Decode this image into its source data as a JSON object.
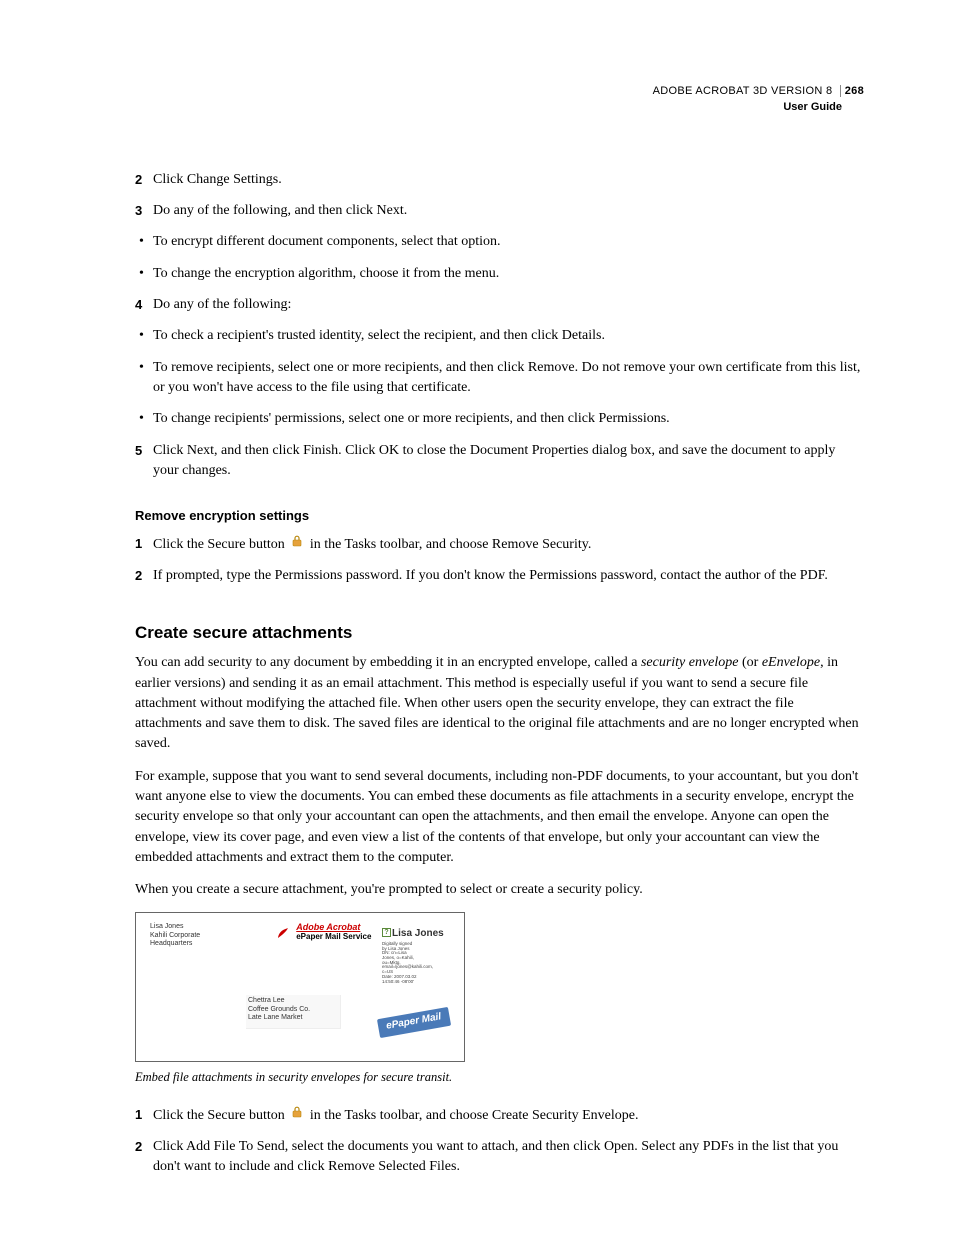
{
  "header": {
    "product": "ADOBE ACROBAT 3D VERSION 8",
    "guide": "User Guide",
    "page_number": "268"
  },
  "steps1": {
    "s2": {
      "num": "2",
      "text": "Click Change Settings."
    },
    "s3": {
      "num": "3",
      "text": "Do any of the following, and then click Next."
    },
    "b3a": "To encrypt different document components, select that option.",
    "b3b": "To change the encryption algorithm, choose it from the menu.",
    "s4": {
      "num": "4",
      "text": "Do any of the following:"
    },
    "b4a": "To check a recipient's trusted identity, select the recipient, and then click Details.",
    "b4b": "To remove recipients, select one or more recipients, and then click Remove. Do not remove your own certificate from this list, or you won't have access to the file using that certificate.",
    "b4c": "To change recipients' permissions, select one or more recipients, and then click Permissions.",
    "s5": {
      "num": "5",
      "text": "Click Next, and then click Finish. Click OK to close the Document Properties dialog box, and save the document to apply your changes."
    }
  },
  "remove": {
    "heading": "Remove encryption settings",
    "s1": {
      "num": "1",
      "pre": "Click the Secure button",
      "post": "in the Tasks toolbar, and choose Remove Security."
    },
    "s2": {
      "num": "2",
      "text": "If prompted, type the Permissions password. If you don't know the Permissions password, contact the author of the PDF."
    }
  },
  "attach": {
    "heading": "Create secure attachments",
    "p1a": "You can add security to any document by embedding it in an encrypted envelope, called a ",
    "p1_term1": "security envelope",
    "p1b": " (or ",
    "p1_term2": "eEnvelope",
    "p1c": ", in earlier versions) and sending it as an email attachment. This method is especially useful if you want to send a secure file attachment without modifying the attached file. When other users open the security envelope, they can extract the file attachments and save them to disk. The saved files are identical to the original file attachments and are no longer encrypted when saved.",
    "p2": "For example, suppose that you want to send several documents, including non-PDF documents, to your accountant, but you don't want anyone else to view the documents. You can embed these documents as file attachments in a security envelope, encrypt the security envelope so that only your accountant can open the attachments, and then email the envelope. Anyone can open the envelope, view its cover page, and even view a list of the contents of that envelope, but only your accountant can view the embedded attachments and extract them to the computer.",
    "p3": "When you create a secure attachment, you're prompted to select or create a security policy."
  },
  "figure": {
    "from": "Lisa Jones\nKahili Corporate\nHeadquarters",
    "brand_line1": "Adobe Acrobat",
    "brand_line2": "ePaper Mail Service",
    "sig_name": "Lisa Jones",
    "sig_meta": "Digitally signed by Lisa Jones\nDN: cn=Lisa Jones, o=Kahili, ou=Mktg, email=ljones@kahili.com, c=US\nDate: 2007.03.02 14:50:46 -08'00'",
    "to": "Chettra Lee\nCoffee Grounds Co.\nLate Lane Market",
    "stamp": "ePaper Mail",
    "caption": "Embed file attachments in security envelopes for secure transit."
  },
  "steps2": {
    "s1": {
      "num": "1",
      "pre": "Click the Secure button",
      "post": "in the Tasks toolbar, and choose Create Security Envelope."
    },
    "s2": {
      "num": "2",
      "text": "Click Add File To Send, select the documents you want to attach, and then click Open. Select any PDFs in the list that you don't want to include and click Remove Selected Files."
    }
  }
}
